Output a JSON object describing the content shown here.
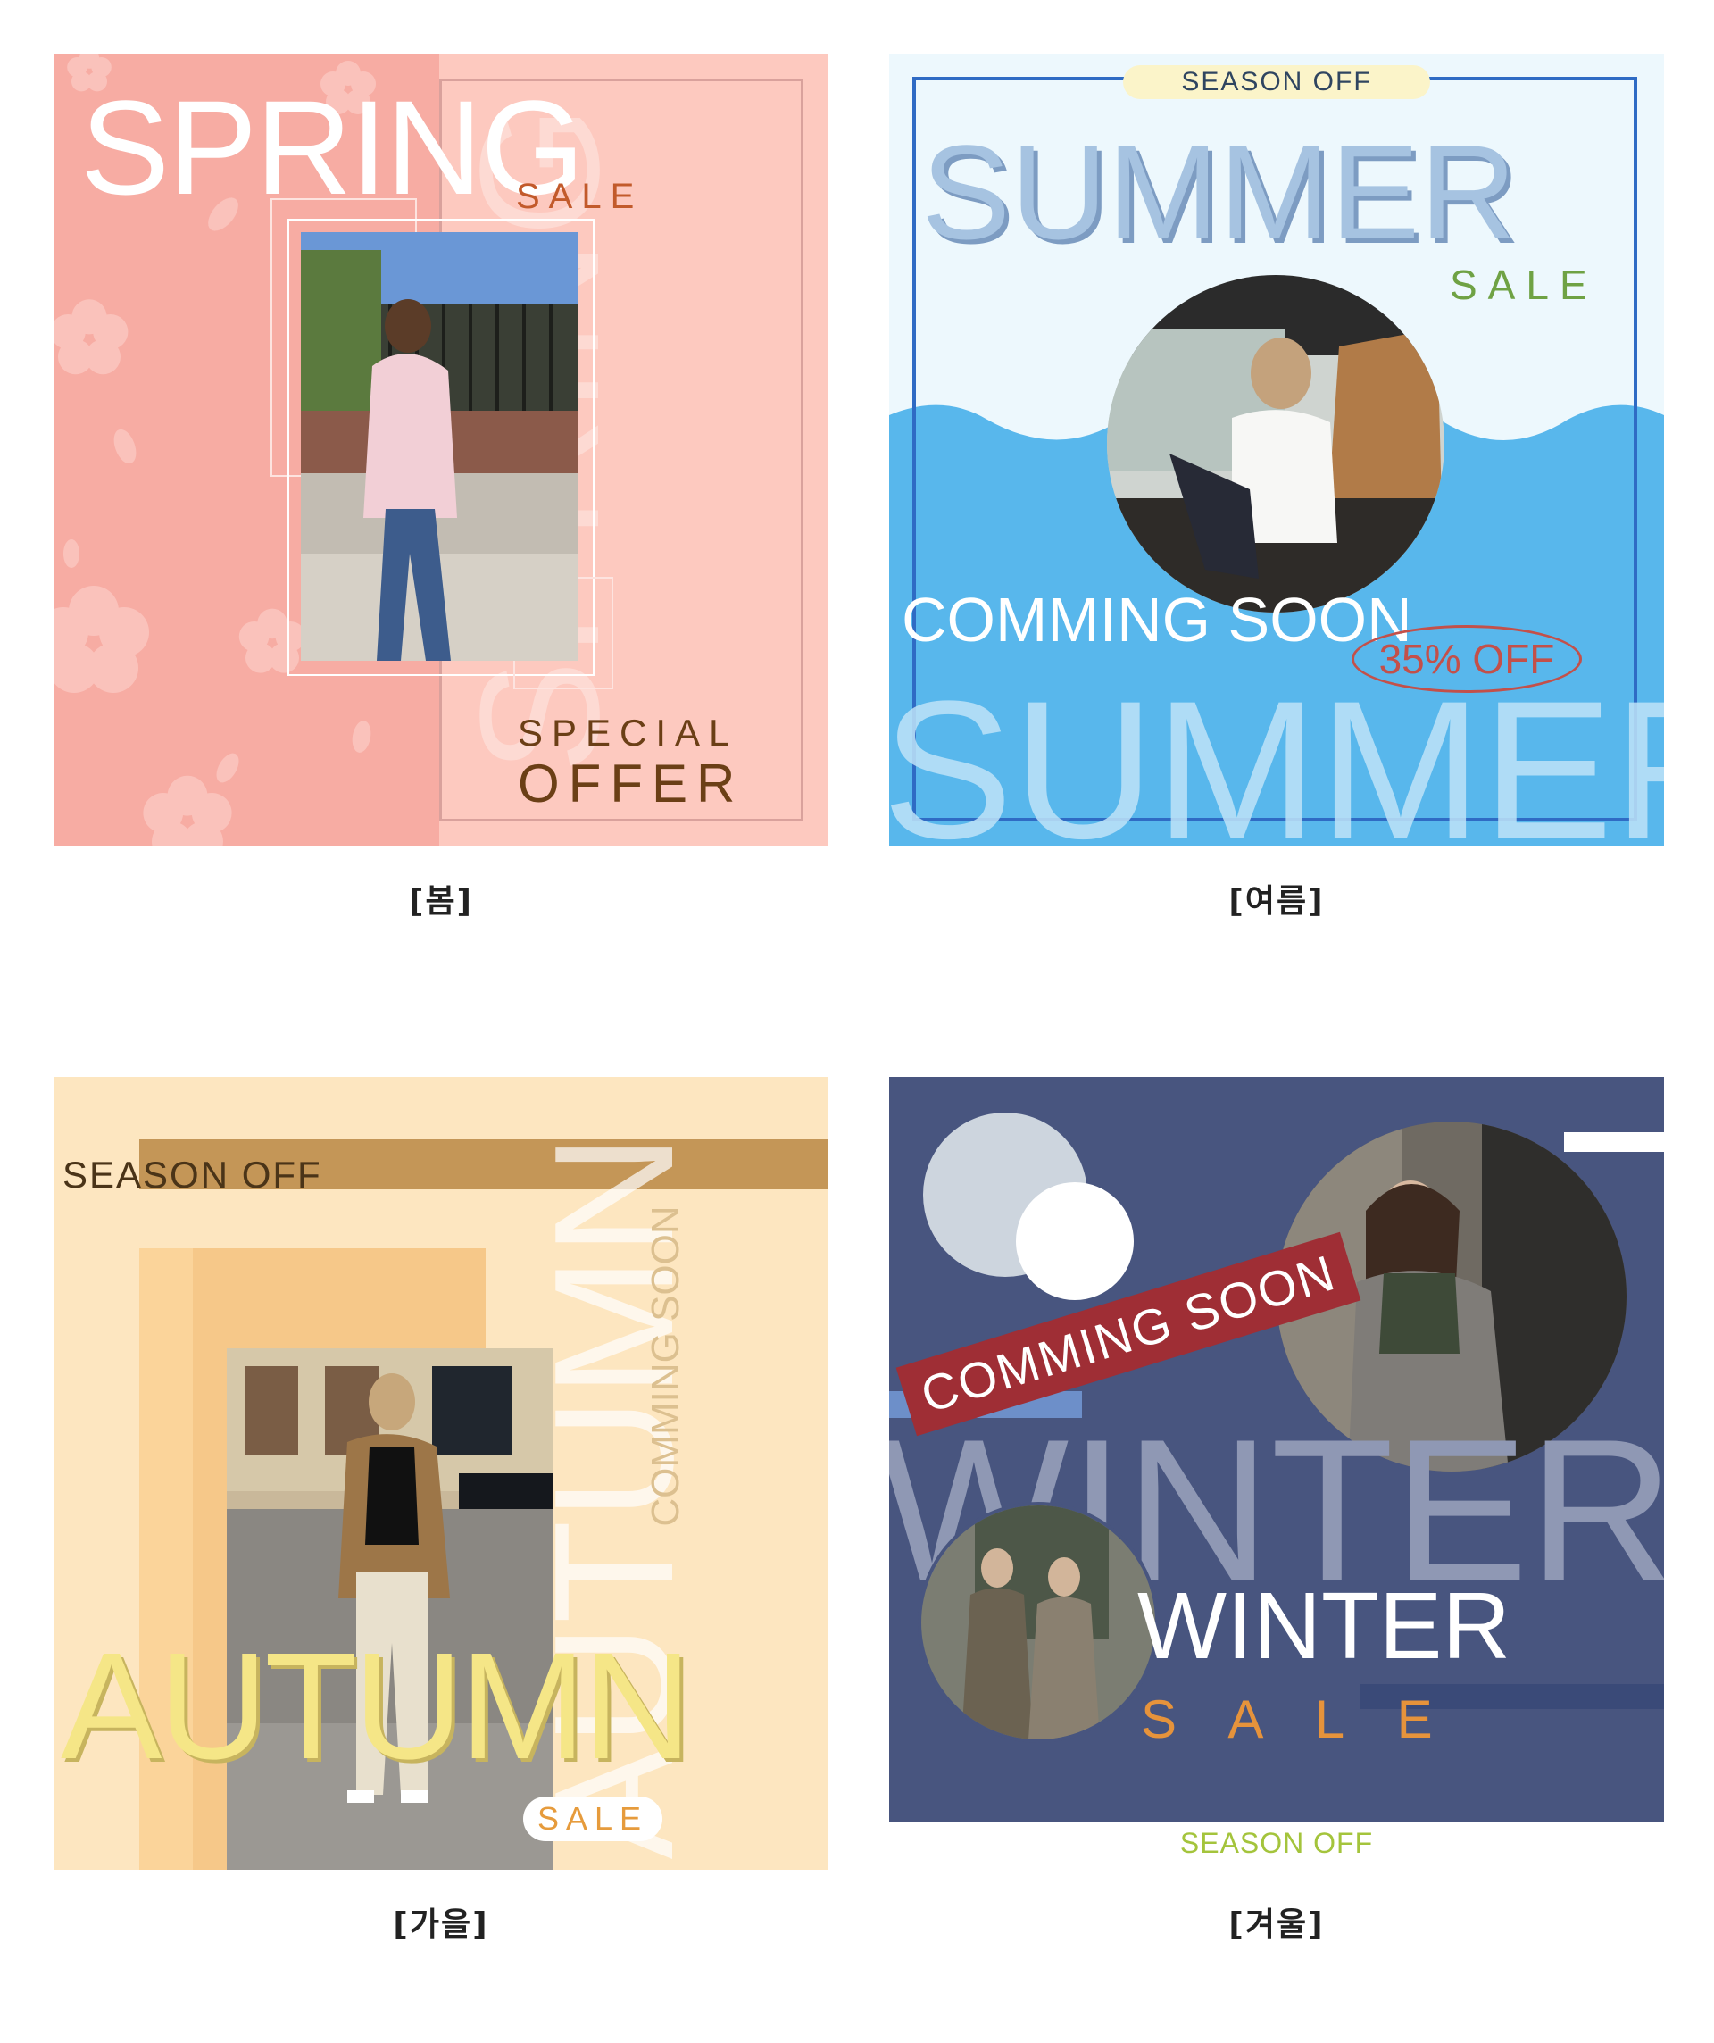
{
  "panels": {
    "spring": {
      "title": "SPRING",
      "sale": "SALE",
      "vertical_title": "SPRING",
      "offer_line1": "SPECIAL",
      "offer_line2": "OFFER",
      "caption": "[봄]"
    },
    "summer": {
      "badge": "SEASON OFF",
      "title": "SUMMER",
      "sale": "SALE",
      "coming": "COMMING SOON",
      "discount": "35% OFF",
      "bg_title": "SUMMER",
      "caption": "[여름]"
    },
    "autumn": {
      "season_off": "SEASON OFF",
      "coming": "COMMING SOON",
      "vertical_title": "AUTUMN",
      "title": "AUTUMN",
      "sale": "SALE",
      "caption": "[가을]"
    },
    "winter": {
      "banner": "COMMING SOON",
      "bg_title": "WINTER",
      "title": "WINTER",
      "sale": "S A L E",
      "season_off": "SEASON OFF",
      "caption": "[겨울]"
    }
  },
  "colors": {
    "spring_bg": "#f7aca3",
    "spring_right": "#fdc9bf",
    "summer_blue": "#58b7ec",
    "autumn_bg": "#fde6c0",
    "winter_bg": "#48557f",
    "winter_banner": "#9f2e35"
  }
}
